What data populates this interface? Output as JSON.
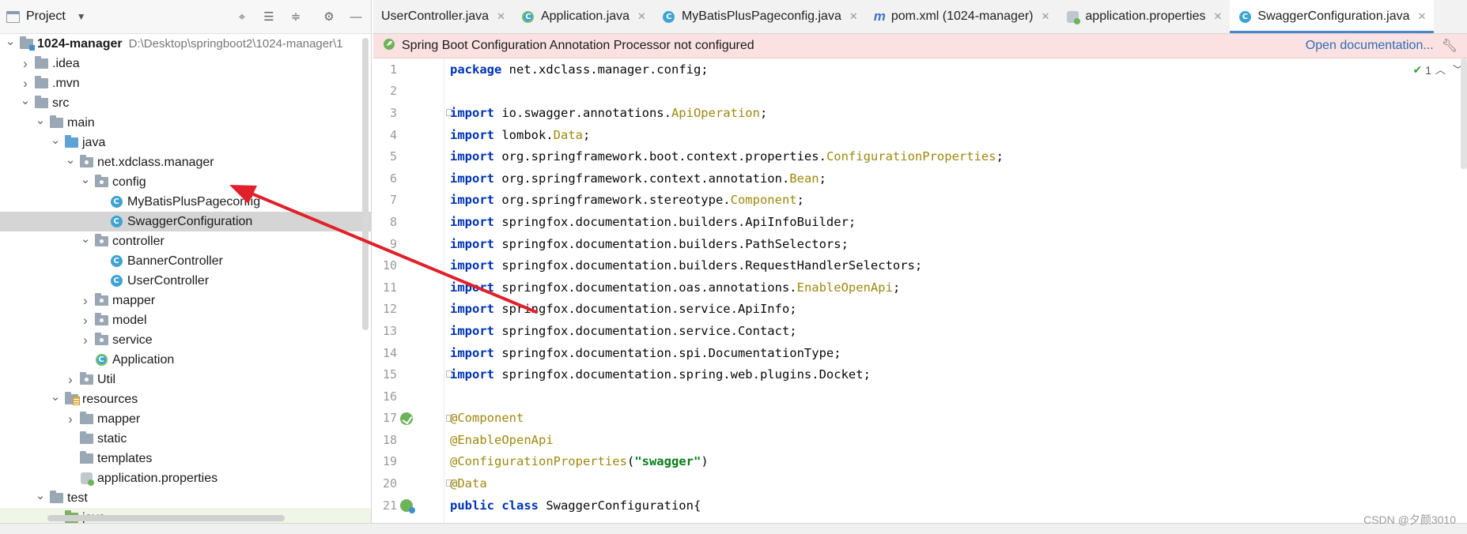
{
  "project_panel": {
    "title": "Project",
    "tree": [
      {
        "label": "1024-manager",
        "path": "D:\\Desktop\\springboot2\\1024-manager\\1",
        "depth": 0,
        "expanded": true,
        "icon": "module-folder-icon",
        "bold": true
      },
      {
        "label": ".idea",
        "depth": 1,
        "expanded": false,
        "icon": "folder-icon"
      },
      {
        "label": ".mvn",
        "depth": 1,
        "expanded": false,
        "icon": "folder-icon"
      },
      {
        "label": "src",
        "depth": 1,
        "expanded": true,
        "icon": "folder-icon"
      },
      {
        "label": "main",
        "depth": 2,
        "expanded": true,
        "icon": "folder-icon"
      },
      {
        "label": "java",
        "depth": 3,
        "expanded": true,
        "icon": "source-folder-icon"
      },
      {
        "label": "net.xdclass.manager",
        "depth": 4,
        "expanded": true,
        "icon": "package-icon"
      },
      {
        "label": "config",
        "depth": 5,
        "expanded": true,
        "icon": "package-icon"
      },
      {
        "label": "MyBatisPlusPageconfig",
        "depth": 6,
        "leaf": true,
        "icon": "class-icon"
      },
      {
        "label": "SwaggerConfiguration",
        "depth": 6,
        "leaf": true,
        "icon": "class-icon",
        "selected": true
      },
      {
        "label": "controller",
        "depth": 5,
        "expanded": true,
        "icon": "package-icon"
      },
      {
        "label": "BannerController",
        "depth": 6,
        "leaf": true,
        "icon": "class-icon"
      },
      {
        "label": "UserController",
        "depth": 6,
        "leaf": true,
        "icon": "class-icon"
      },
      {
        "label": "mapper",
        "depth": 5,
        "expanded": false,
        "icon": "package-icon"
      },
      {
        "label": "model",
        "depth": 5,
        "expanded": false,
        "icon": "package-icon"
      },
      {
        "label": "service",
        "depth": 5,
        "expanded": false,
        "icon": "package-icon"
      },
      {
        "label": "Application",
        "depth": 5,
        "leaf": true,
        "icon": "spring-boot-class-icon"
      },
      {
        "label": "Util",
        "depth": 4,
        "expanded": false,
        "icon": "package-icon"
      },
      {
        "label": "resources",
        "depth": 3,
        "expanded": true,
        "icon": "resources-folder-icon"
      },
      {
        "label": "mapper",
        "depth": 4,
        "expanded": false,
        "icon": "folder-icon"
      },
      {
        "label": "static",
        "depth": 4,
        "leaf": true,
        "icon": "folder-icon"
      },
      {
        "label": "templates",
        "depth": 4,
        "leaf": true,
        "icon": "folder-icon"
      },
      {
        "label": "application.properties",
        "depth": 4,
        "leaf": true,
        "icon": "properties-file-icon"
      },
      {
        "label": "test",
        "depth": 2,
        "expanded": true,
        "icon": "folder-icon"
      },
      {
        "label": "java",
        "depth": 3,
        "expanded": true,
        "icon": "test-source-folder-icon",
        "test": true
      }
    ]
  },
  "tabs": [
    {
      "label": "UserController.java",
      "icon": "none",
      "active": false
    },
    {
      "label": "Application.java",
      "icon": "spring-boot-class-icon",
      "active": false
    },
    {
      "label": "MyBatisPlusPageconfig.java",
      "icon": "class-icon",
      "active": false
    },
    {
      "label": "pom.xml (1024-manager)",
      "icon": "maven-icon",
      "active": false
    },
    {
      "label": "application.properties",
      "icon": "properties-file-icon",
      "active": false
    },
    {
      "label": "SwaggerConfiguration.java",
      "icon": "class-icon",
      "active": true
    }
  ],
  "banner": {
    "message": "Spring Boot Configuration Annotation Processor not configured",
    "link": "Open documentation..."
  },
  "inspection": {
    "count": "1"
  },
  "code_lines": [
    {
      "n": "1",
      "tokens": [
        [
          "kw",
          "package"
        ],
        [
          "plain",
          " net.xdclass.manager.config;"
        ]
      ]
    },
    {
      "n": "2",
      "tokens": []
    },
    {
      "n": "3",
      "fold": true,
      "tokens": [
        [
          "kw",
          "import"
        ],
        [
          "plain",
          " io.swagger.annotations."
        ],
        [
          "ann",
          "ApiOperation"
        ],
        [
          "plain",
          ";"
        ]
      ]
    },
    {
      "n": "4",
      "tokens": [
        [
          "kw",
          "import"
        ],
        [
          "plain",
          " lombok."
        ],
        [
          "ann",
          "Data"
        ],
        [
          "plain",
          ";"
        ]
      ]
    },
    {
      "n": "5",
      "tokens": [
        [
          "kw",
          "import"
        ],
        [
          "plain",
          " org.springframework.boot.context.properties."
        ],
        [
          "ann",
          "ConfigurationProperties"
        ],
        [
          "plain",
          ";"
        ]
      ]
    },
    {
      "n": "6",
      "tokens": [
        [
          "kw",
          "import"
        ],
        [
          "plain",
          " org.springframework.context.annotation."
        ],
        [
          "ann",
          "Bean"
        ],
        [
          "plain",
          ";"
        ]
      ]
    },
    {
      "n": "7",
      "tokens": [
        [
          "kw",
          "import"
        ],
        [
          "plain",
          " org.springframework.stereotype."
        ],
        [
          "ann",
          "Component"
        ],
        [
          "plain",
          ";"
        ]
      ]
    },
    {
      "n": "8",
      "tokens": [
        [
          "kw",
          "import"
        ],
        [
          "plain",
          " springfox.documentation.builders.ApiInfoBuilder;"
        ]
      ]
    },
    {
      "n": "9",
      "tokens": [
        [
          "kw",
          "import"
        ],
        [
          "plain",
          " springfox.documentation.builders.PathSelectors;"
        ]
      ]
    },
    {
      "n": "10",
      "tokens": [
        [
          "kw",
          "import"
        ],
        [
          "plain",
          " springfox.documentation.builders.RequestHandlerSelectors;"
        ]
      ]
    },
    {
      "n": "11",
      "tokens": [
        [
          "kw",
          "import"
        ],
        [
          "plain",
          " springfox.documentation.oas.annotations."
        ],
        [
          "ann",
          "EnableOpenApi"
        ],
        [
          "plain",
          ";"
        ]
      ]
    },
    {
      "n": "12",
      "tokens": [
        [
          "kw",
          "import"
        ],
        [
          "plain",
          " springfox.documentation.service.ApiInfo;"
        ]
      ]
    },
    {
      "n": "13",
      "tokens": [
        [
          "kw",
          "import"
        ],
        [
          "plain",
          " springfox.documentation.service.Contact;"
        ]
      ]
    },
    {
      "n": "14",
      "tokens": [
        [
          "kw",
          "import"
        ],
        [
          "plain",
          " springfox.documentation.spi.DocumentationType;"
        ]
      ]
    },
    {
      "n": "15",
      "fold": true,
      "tokens": [
        [
          "kw",
          "import"
        ],
        [
          "plain",
          " springfox.documentation.spring.web.plugins.Docket;"
        ]
      ]
    },
    {
      "n": "16",
      "tokens": []
    },
    {
      "n": "17",
      "fold": true,
      "gutter": "bean-icon",
      "tokens": [
        [
          "ann",
          "@Component"
        ]
      ]
    },
    {
      "n": "18",
      "tokens": [
        [
          "ann",
          "@EnableOpenApi"
        ]
      ]
    },
    {
      "n": "19",
      "tokens": [
        [
          "ann",
          "@ConfigurationProperties"
        ],
        [
          "plain",
          "("
        ],
        [
          "str",
          "\"swagger\""
        ],
        [
          "plain",
          ")"
        ]
      ]
    },
    {
      "n": "20",
      "fold": true,
      "tokens": [
        [
          "ann",
          "@Data"
        ]
      ]
    },
    {
      "n": "21",
      "gutter": "run-icon",
      "tokens": [
        [
          "kw",
          "public class"
        ],
        [
          "plain",
          " SwaggerConfiguration{"
        ]
      ]
    }
  ],
  "watermark": "CSDN @夕颜3010",
  "colors": {
    "keyword": "#0033b3",
    "annotation": "#9e880d",
    "string": "#067d17",
    "selection": "#d5d5d5",
    "banner_bg": "#fbe1e1",
    "arrow": "#e0202a",
    "active_tab_underline": "#4a86c8"
  }
}
